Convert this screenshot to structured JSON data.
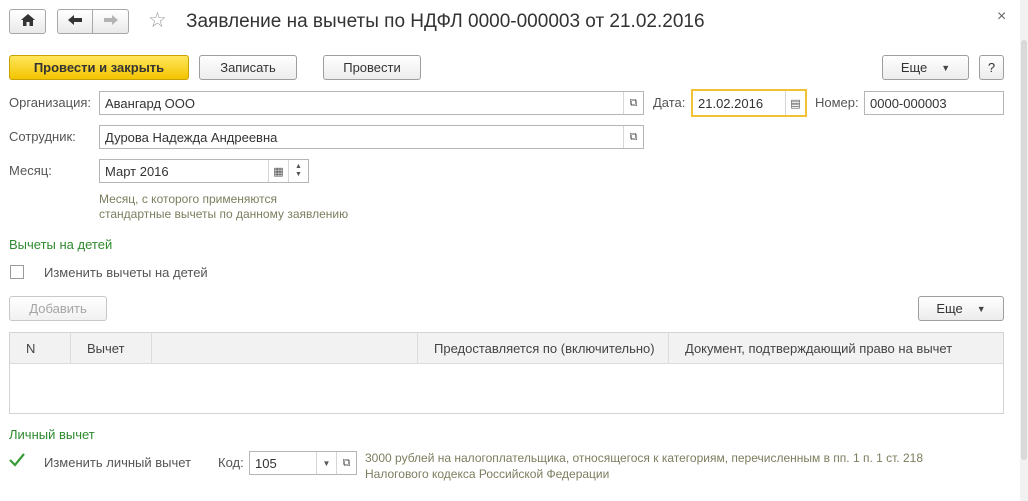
{
  "window": {
    "title": "Заявление на вычеты по НДФЛ 0000-000003 от 21.02.2016",
    "close_glyph": "×",
    "favorite_glyph": "☆"
  },
  "nav": {
    "home_glyph": "⌂",
    "back_glyph": "←",
    "forward_glyph": "→"
  },
  "toolbar": {
    "post_close_label": "Провести и закрыть",
    "write_label": "Записать",
    "post_label": "Провести",
    "more_label": "Еще",
    "help_label": "?"
  },
  "form": {
    "organization_label": "Организация:",
    "organization_value": "Авангард ООО",
    "date_label": "Дата:",
    "date_value": "21.02.2016",
    "number_label": "Номер:",
    "number_value": "0000-000003",
    "employee_label": "Сотрудник:",
    "employee_value": "Дурова Надежда Андреевна",
    "month_label": "Месяц:",
    "month_value": "Март 2016",
    "month_hint_line1": "Месяц, с которого применяются",
    "month_hint_line2": "стандартные вычеты по данному заявлению"
  },
  "children": {
    "section_title": "Вычеты на детей",
    "change_checkbox_label": "Изменить вычеты на детей",
    "change_checked": false,
    "add_label": "Добавить",
    "more_label": "Еще",
    "table_headers": [
      "N",
      "Вычет",
      "",
      "Предоставляется по (включительно)",
      "Документ, подтверждающий право на вычет"
    ],
    "rows": []
  },
  "personal": {
    "section_title": "Личный вычет",
    "change_checkbox_label": "Изменить личный вычет",
    "change_checked": true,
    "code_label": "Код:",
    "code_value": "105",
    "description_line1": "3000 рублей на налогоплательщика, относящегося к категориям, перечисленным в пп. 1 п. 1 ст. 218",
    "description_line2": "Налогового кодекса Российской Федерации"
  },
  "colors": {
    "primary_button": "#f3c400",
    "section_title": "#2e8a2e",
    "hint_text": "#7d7d5f",
    "active_border": "#f1c232"
  }
}
